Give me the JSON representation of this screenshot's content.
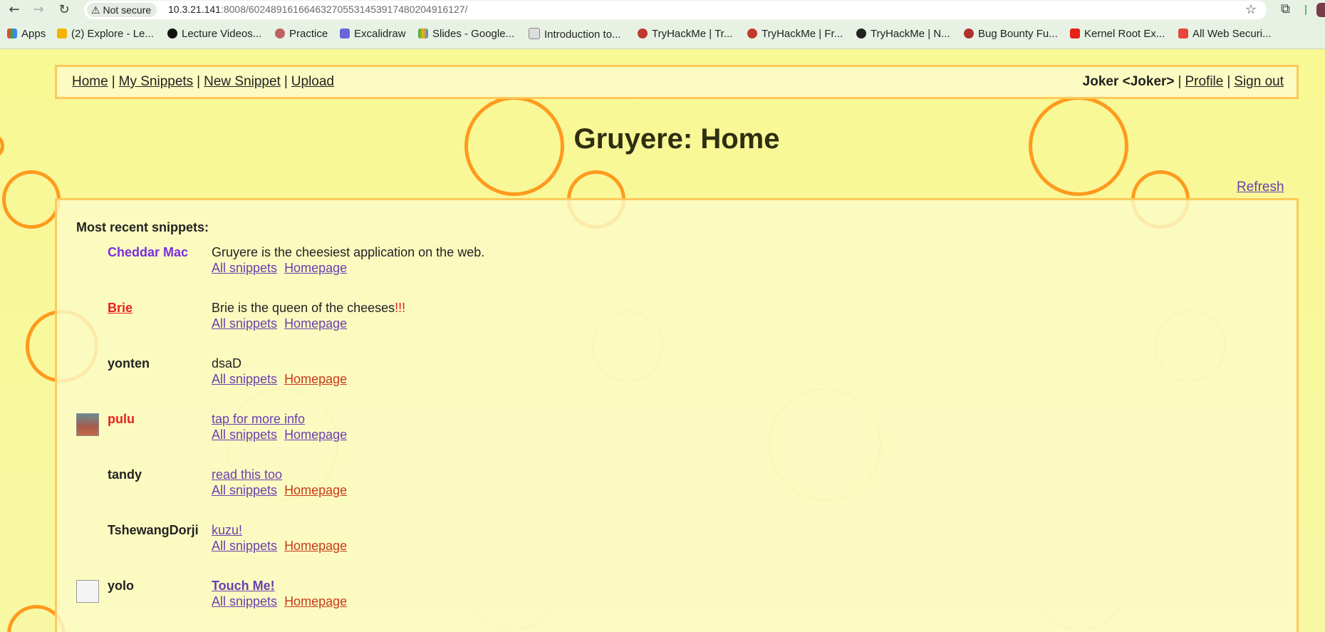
{
  "browser": {
    "security_label": "Not secure",
    "url_host": "10.3.21.141",
    "url_path": ":8008/602489161664632705531453917480204916127/",
    "bookmarks": [
      {
        "label": "Apps",
        "color": "#e8453c"
      },
      {
        "label": "(2) Explore - Le...",
        "color": "#f4b400"
      },
      {
        "label": "Lecture Videos...",
        "color": "#111111"
      },
      {
        "label": "Practice",
        "color": "#c06060"
      },
      {
        "label": "Excalidraw",
        "color": "#6965db"
      },
      {
        "label": "Slides - Google...",
        "color": "#f4b400"
      },
      {
        "label": "Introduction to...",
        "color": "#888888"
      },
      {
        "label": "TryHackMe | Tr...",
        "color": "#c0392b"
      },
      {
        "label": "TryHackMe | Fr...",
        "color": "#c0392b"
      },
      {
        "label": "TryHackMe | N...",
        "color": "#222222"
      },
      {
        "label": "Bug Bounty Fu...",
        "color": "#b03030"
      },
      {
        "label": "Kernel Root Ex...",
        "color": "#e62117"
      },
      {
        "label": "All Web Securi...",
        "color": "#e8453c"
      }
    ]
  },
  "menu": {
    "home": "Home",
    "my_snippets": "My Snippets",
    "new_snippet": "New Snippet",
    "upload": "Upload",
    "user": "Joker <Joker>",
    "profile": "Profile",
    "sign_out": "Sign out",
    "separator": "|"
  },
  "page": {
    "title": "Gruyere: Home",
    "refresh": "Refresh",
    "recent_label": "Most recent snippets:"
  },
  "snippets": [
    {
      "author": "Cheddar Mac",
      "text": "Gruyere is the cheesiest application on the web.",
      "all": "All snippets",
      "homepage": "Homepage"
    },
    {
      "author": "Brie",
      "text": "Brie is the queen of the cheeses",
      "text_suffix": "!!!",
      "all": "All snippets",
      "homepage": "Homepage"
    },
    {
      "author": "yonten",
      "text": "dsaD",
      "all": "All snippets",
      "homepage": "Homepage"
    },
    {
      "author": "pulu",
      "text": "tap for more info",
      "all": "All snippets",
      "homepage": "Homepage"
    },
    {
      "author": "tandy",
      "text": "read this too",
      "all": "All snippets",
      "homepage": "Homepage"
    },
    {
      "author": "TshewangDorji",
      "text": "kuzu!",
      "all": "All snippets",
      "homepage": "Homepage"
    },
    {
      "author": "yolo",
      "text": "Touch Me!",
      "all": "All snippets",
      "homepage": "Homepage"
    }
  ]
}
